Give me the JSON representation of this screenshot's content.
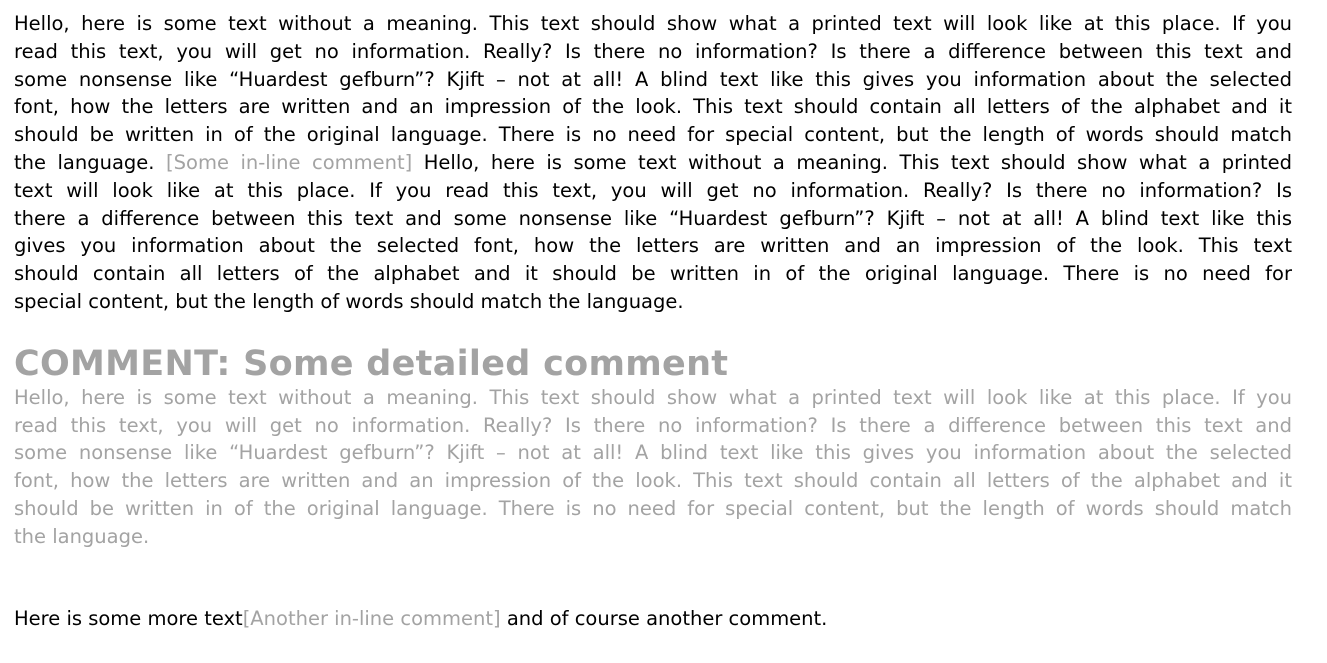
{
  "paragraph1": {
    "lines": [
      "Hello, here is some text without a meaning. This text should show what a printed text will look like at this place. If you",
      "read this text, you will get no information. Really? Is there no information? Is there a difference between this text and",
      "some nonsense like “Huardest gefburn”? Kjift – not at all! A blind text like this gives you information about the selected",
      "font, how the letters are written and an impression of the look. This text should contain all letters of the alphabet and it",
      "should be written in of the original language. There is no need for special content, but the length of words should match"
    ],
    "line6_before": "the language. ",
    "inline_comment": "[Some in-line comment]",
    "line6_after": " Hello, here is some text without a meaning. This text should show what a printed",
    "lines_rest": [
      "text will look like at this place. If you read this text, you will get no information. Really? Is there no information? Is",
      "there a difference between this text and some nonsense like “Huardest gefburn”? Kjift – not at all! A blind text like this",
      "gives you information about the selected font, how the letters are written and an impression of the look. This text",
      "should contain all letters of the alphabet and it should be written in of the original language. There is no need for",
      "special content, but the length of words should match the language."
    ]
  },
  "comment": {
    "heading": "COMMENT: Some detailed comment",
    "lines": [
      "Hello, here is some text without a meaning. This text should show what a printed text will look like at this place. If you",
      "read this text, you will get no information. Really? Is there no information? Is there a difference between this text and",
      "some nonsense like “Huardest gefburn”? Kjift – not at all! A blind text like this gives you information about the selected",
      "font, how the letters are written and an impression of the look. This text should contain all letters of the alphabet and it",
      "should be written in of the original language. There is no need for special content, but the length of words should match",
      "the language."
    ]
  },
  "paragraph2": {
    "before": "Here is some more text",
    "inline_comment": "[Another in-line comment]",
    "after": " and of course another comment."
  },
  "colors": {
    "text": "#000000",
    "comment": "#a3a3a3"
  }
}
